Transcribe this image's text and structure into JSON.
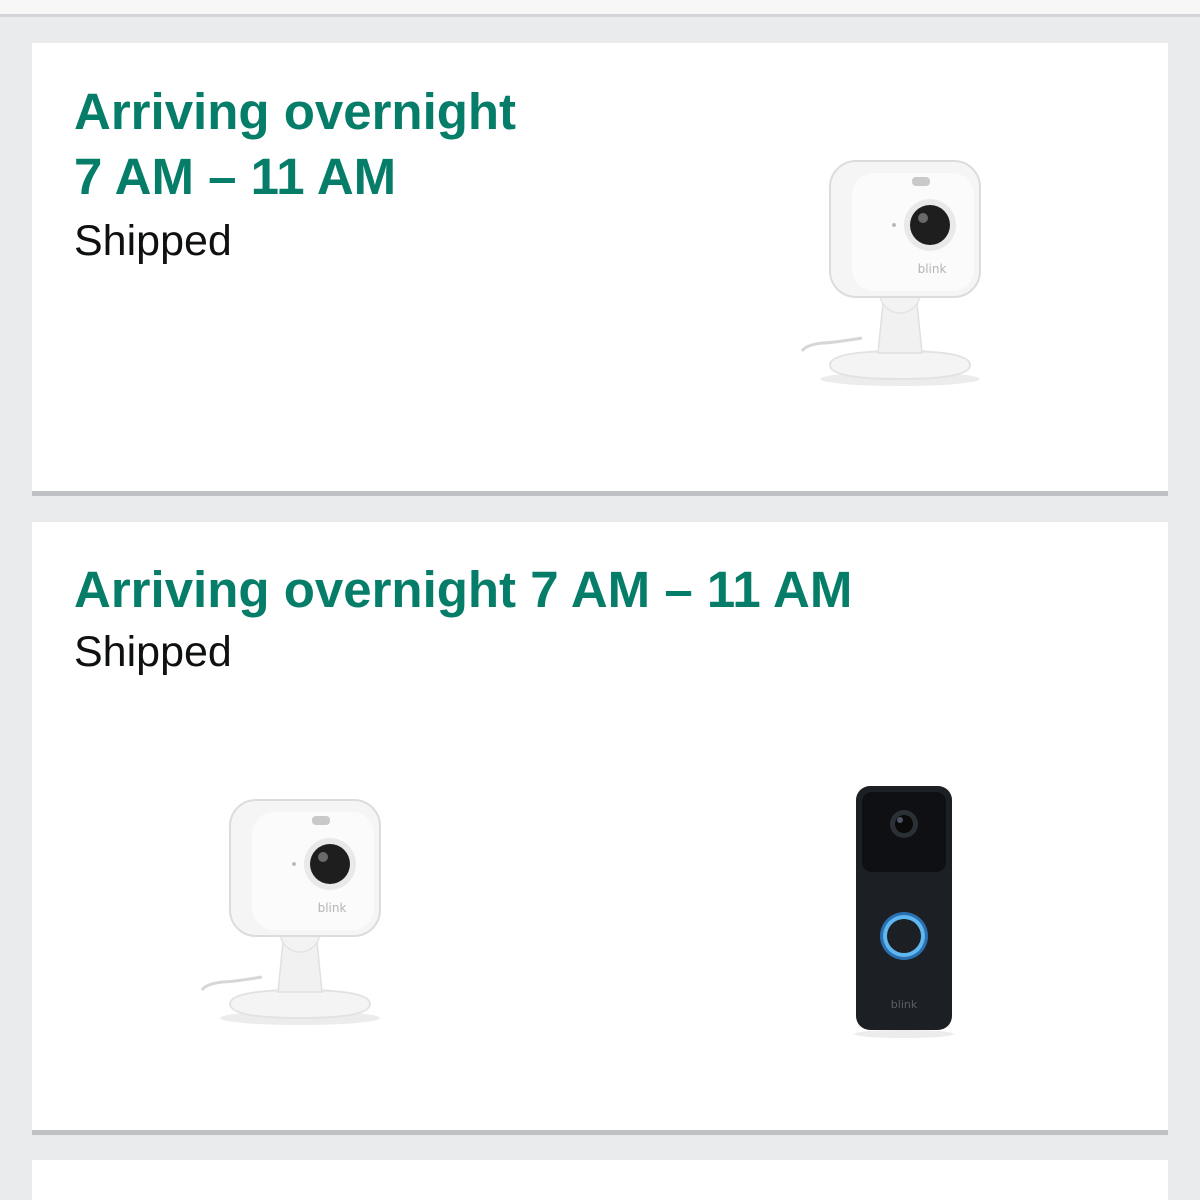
{
  "shipments": [
    {
      "arrival_line1": "Arriving overnight",
      "arrival_line2": "7 AM – 11 AM",
      "status": "Shipped",
      "items": [
        {
          "product": "indoor camera",
          "icon": "blink-mini-camera-image",
          "brand": "blink"
        }
      ]
    },
    {
      "arrival_line1": "Arriving overnight 7 AM – 11 AM",
      "status": "Shipped",
      "items": [
        {
          "product": "indoor camera",
          "icon": "blink-mini-camera-image",
          "brand": "blink"
        },
        {
          "product": "video doorbell",
          "icon": "blink-video-doorbell-image",
          "brand": "blink"
        }
      ]
    }
  ],
  "colors": {
    "arrival_text": "#067d68",
    "status_text": "#0f1111",
    "page_background": "#eaebed",
    "card_background": "#ffffff"
  }
}
